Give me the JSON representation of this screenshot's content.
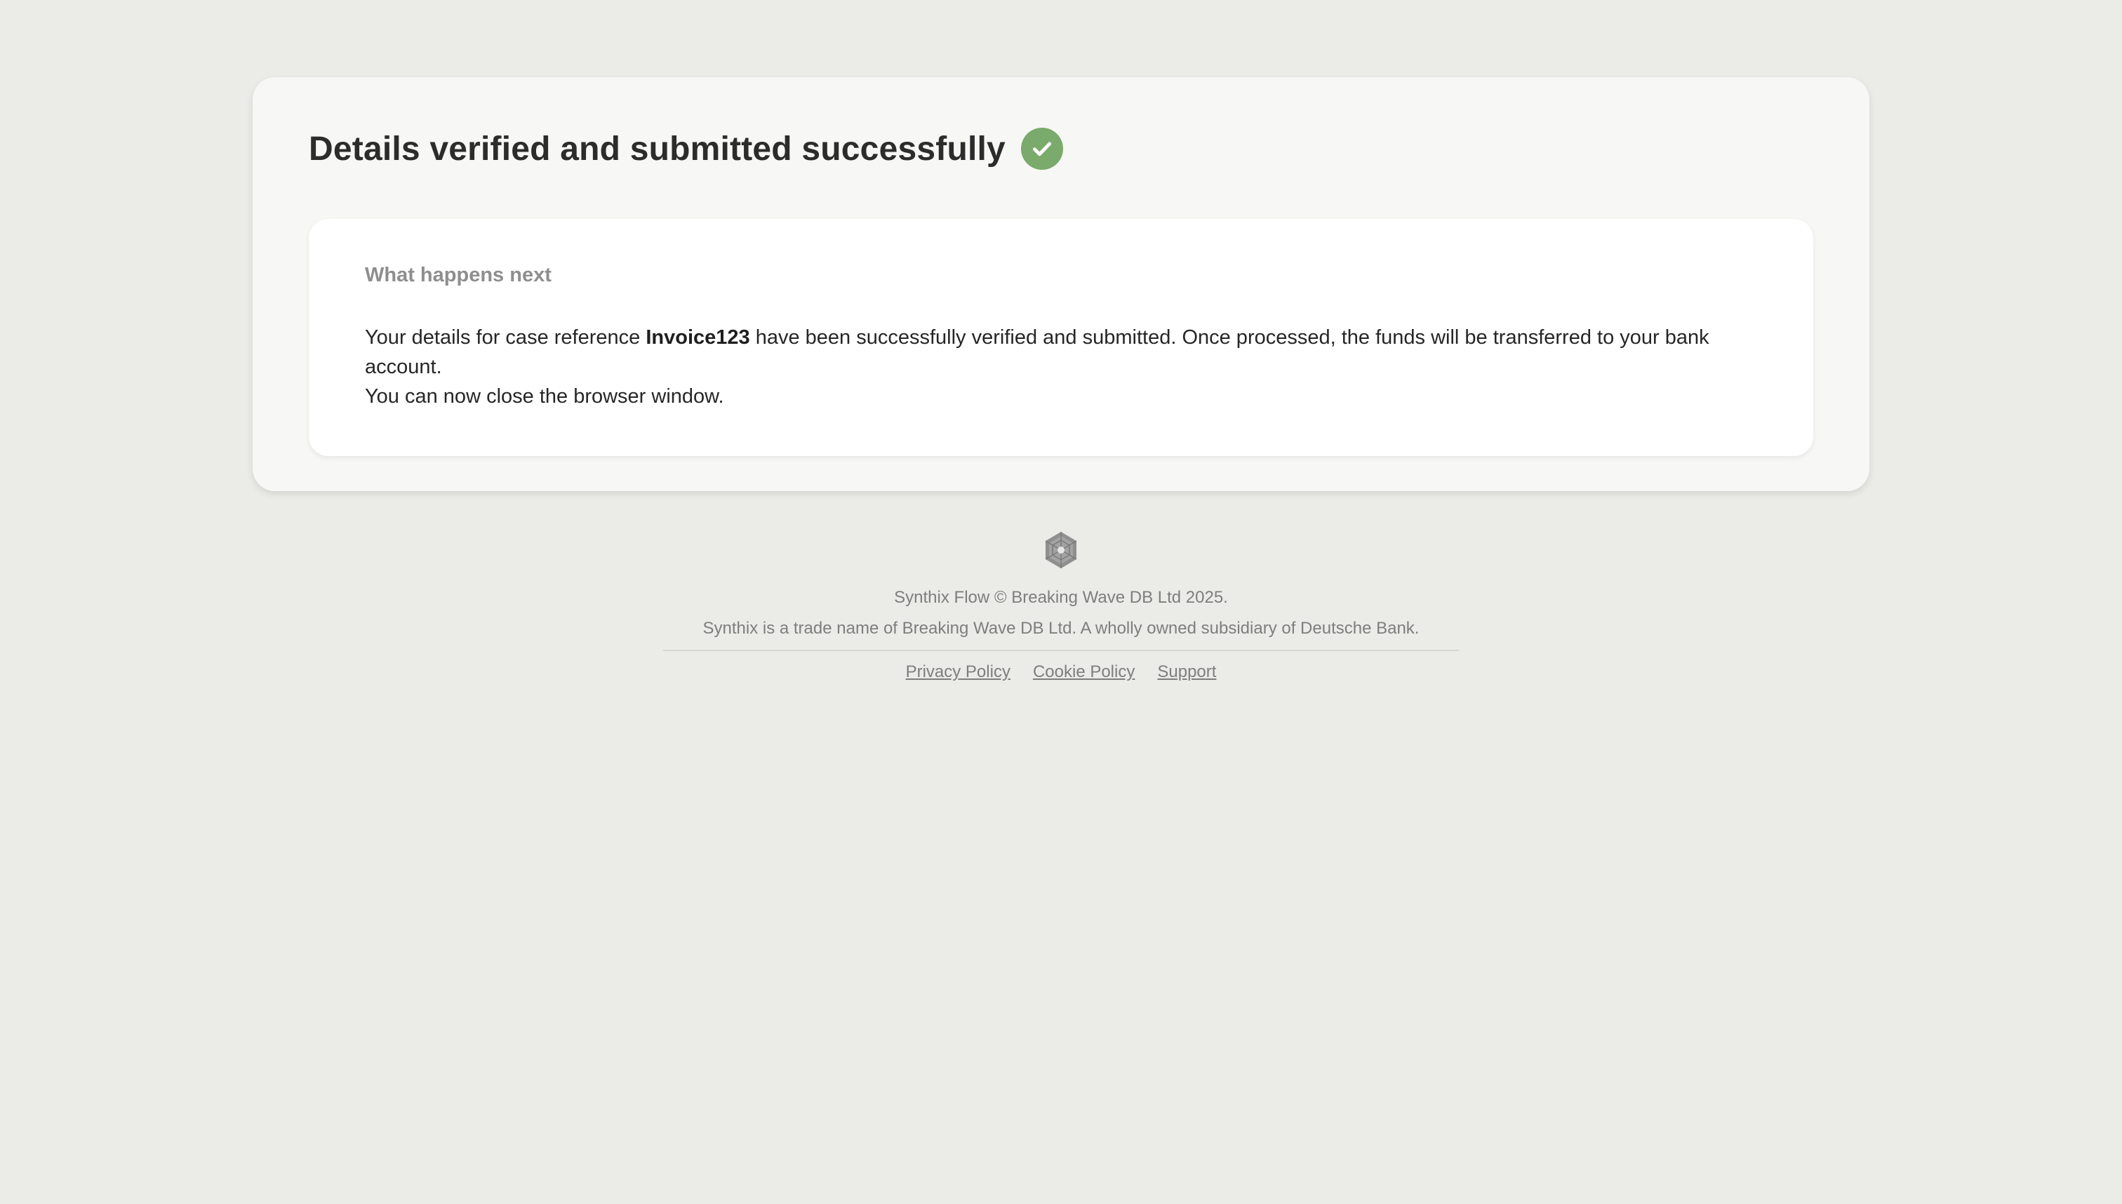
{
  "card": {
    "title": "Details verified and submitted successfully",
    "status_icon": "check-circle-icon",
    "status_color": "#7aaa6c"
  },
  "next_steps": {
    "heading": "What happens next",
    "text_before_ref": "Your details for case reference ",
    "case_reference": "Invoice123",
    "text_after_ref": " have been successfully verified and submitted. Once processed, the funds will be transferred to your bank account.",
    "close_note": "You can now close the browser window."
  },
  "footer": {
    "logo_icon": "synthix-logo-icon",
    "copyright": "Synthix Flow © Breaking Wave DB Ltd 2025.",
    "trade_notice": "Synthix is a trade name of Breaking Wave DB Ltd. A wholly owned subsidiary of Deutsche Bank.",
    "links": {
      "privacy": "Privacy Policy",
      "cookie": "Cookie Policy",
      "support": "Support"
    }
  }
}
